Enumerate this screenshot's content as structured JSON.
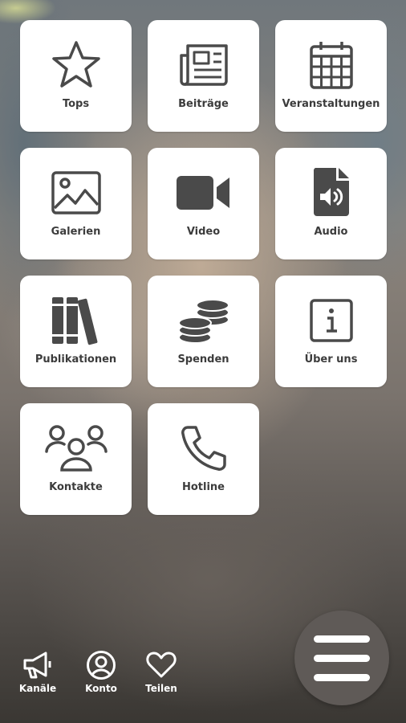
{
  "tiles": [
    {
      "label": "Tops",
      "icon": "star-icon"
    },
    {
      "label": "Beiträge",
      "icon": "newspaper-icon"
    },
    {
      "label": "Veranstaltungen",
      "icon": "calendar-icon"
    },
    {
      "label": "Galerien",
      "icon": "image-icon"
    },
    {
      "label": "Video",
      "icon": "video-camera-icon"
    },
    {
      "label": "Audio",
      "icon": "audio-file-icon"
    },
    {
      "label": "Publikationen",
      "icon": "books-icon"
    },
    {
      "label": "Spenden",
      "icon": "coins-icon"
    },
    {
      "label": "Über uns",
      "icon": "info-icon"
    },
    {
      "label": "Kontakte",
      "icon": "users-icon"
    },
    {
      "label": "Hotline",
      "icon": "phone-icon"
    }
  ],
  "bottom_nav": [
    {
      "label": "Kanäle",
      "icon": "megaphone-icon"
    },
    {
      "label": "Konto",
      "icon": "user-circle-icon"
    },
    {
      "label": "Teilen",
      "icon": "heart-icon"
    }
  ],
  "menu_button": {
    "icon": "menu-icon"
  },
  "colors": {
    "tile": "#ffffff",
    "icon": "#4a4a4a",
    "label": "#3c3c3c",
    "fab": "#5f5a57"
  }
}
